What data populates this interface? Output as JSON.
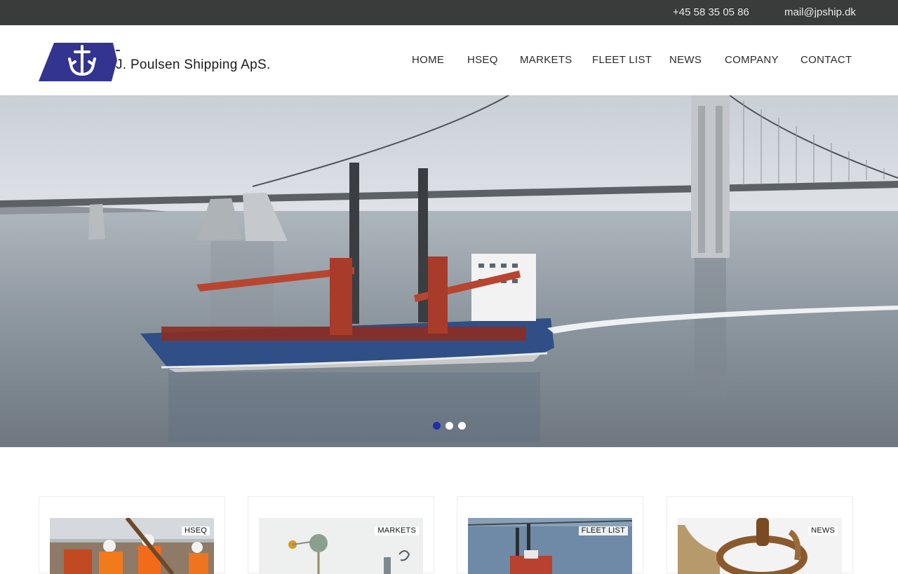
{
  "topbar": {
    "phone": "+45 58 35 05 86",
    "email": "mail@jpship.dk"
  },
  "brand": {
    "name": "J. Poulsen Shipping ApS.",
    "logo_color": "#33348f"
  },
  "nav": {
    "items": [
      {
        "label": "HOME"
      },
      {
        "label": "HSEQ"
      },
      {
        "label": "MARKETS"
      },
      {
        "label": "FLEET LIST"
      },
      {
        "label": "NEWS"
      },
      {
        "label": "COMPANY"
      },
      {
        "label": "CONTACT"
      }
    ]
  },
  "slider": {
    "slide_count": 3,
    "active_slide": 1,
    "active_color": "#1f2fa8"
  },
  "cards": [
    {
      "label": "HSEQ"
    },
    {
      "label": "MARKETS"
    },
    {
      "label": "FLEET LIST"
    },
    {
      "label": "NEWS"
    }
  ]
}
